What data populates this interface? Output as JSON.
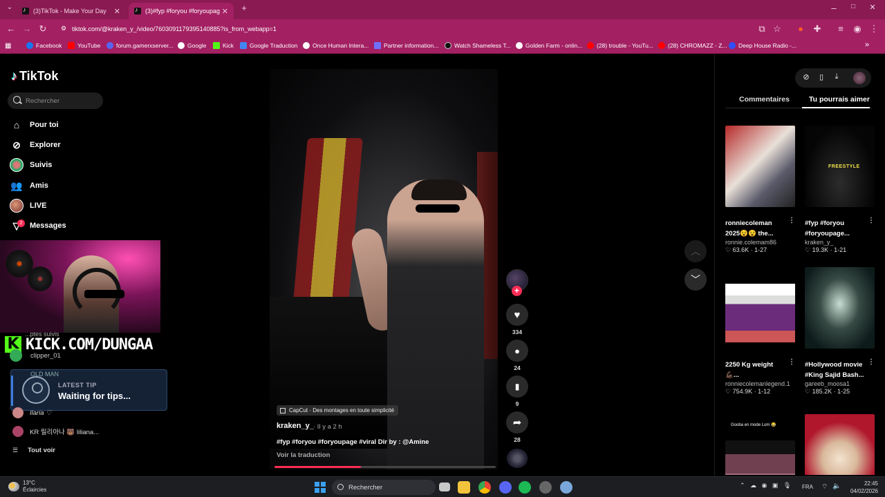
{
  "browser": {
    "tabs": [
      {
        "title": "(3)TikTok - Make Your Day",
        "active": false
      },
      {
        "title": "(3)#fyp #foryou #foryoupage #",
        "active": true
      }
    ],
    "new_tab": "+",
    "url": "tiktok.com/@kraken_y_/video/7603091179395140885?is_from_webapp=1",
    "bookmarks": [
      {
        "label": "Facebook",
        "color": "#1877f2"
      },
      {
        "label": "YouTube",
        "color": "#ff0000"
      },
      {
        "label": "forum.gamerxserver...",
        "color": "#5865f2"
      },
      {
        "label": "Google",
        "color": "#ffffff"
      },
      {
        "label": "Kick",
        "color": "#53fc18"
      },
      {
        "label": "Google Traduction",
        "color": "#4285f4"
      },
      {
        "label": "Once Human Intera...",
        "color": "#ffffff"
      },
      {
        "label": "Partner information...",
        "color": "#7070ff"
      },
      {
        "label": "Watch Shameless T...",
        "color": "#111111"
      },
      {
        "label": "Golden Farm - onlin...",
        "color": "#ffffff"
      },
      {
        "label": "(28) trouble - YouTu...",
        "color": "#ff0000"
      },
      {
        "label": "(28) CHROMAZZ - Z...",
        "color": "#ff0000"
      },
      {
        "label": "Deep House Radio -...",
        "color": "#3050ff"
      }
    ],
    "more_bookmarks": "»"
  },
  "sidebar": {
    "logo": "TikTok",
    "search_placeholder": "Rechercher",
    "items": [
      {
        "label": "Pour toi",
        "icon": "home-icon"
      },
      {
        "label": "Explorer",
        "icon": "compass-icon"
      },
      {
        "label": "Suivis",
        "icon": "avatar-icon"
      },
      {
        "label": "Amis",
        "icon": "friends-icon"
      },
      {
        "label": "LIVE",
        "icon": "live-avatar-icon"
      },
      {
        "label": "Messages",
        "icon": "messages-icon"
      }
    ],
    "messages_badge": "2",
    "followed_header": "...ptes suivis",
    "followed": [
      {
        "name": "clipper_01"
      },
      {
        "name": "Ilaria ♡"
      },
      {
        "name": "KR 릴리아나 🐻 liliana..."
      }
    ],
    "see_all": "Tout voir"
  },
  "overlay": {
    "kick_logo": "K",
    "kick_text": "KICK.COM/DUNGAA",
    "tip_user": "OLD MAN",
    "tip_label": "LATEST TIP",
    "tip_message": "Waiting for tips..."
  },
  "video": {
    "capcut": "CapCut · Des montages en toute simplicité",
    "author": "kraken_y_",
    "time_ago": "· Il y a 2 h",
    "caption": "#fyp #foryou #foryoupage #viral Dir by : @Amine",
    "translate": "Voir la traduction",
    "progress": 0.39
  },
  "actions": {
    "likes": "334",
    "comments": "24",
    "saves": "9",
    "shares": "28"
  },
  "right_panel": {
    "tabs": [
      "Commentaires",
      "Tu pourrais aimer"
    ],
    "active_tab": "Tu pourrais aimer",
    "cards": [
      {
        "title": "ronniecoleman 2025😵😵 the...",
        "user": "ronnie.colemam86",
        "stats": "♡ 63.6K · 1-27"
      },
      {
        "title": "#fyp #foryou #foryoupage...",
        "user": "kraken_y_",
        "stats": "♡ 19.3K · 1-21",
        "thumb_text": "FREESTYLE"
      },
      {
        "title": "2250 Kg weight 💪🏿...",
        "user": "ronniecolemanlegend.1",
        "stats": "♡ 754.9K · 1-12"
      },
      {
        "title": "#Hollywood movie #King Sajid Bash...",
        "user": "gareeb_moosa1",
        "stats": "♡ 185.2K · 1-25"
      },
      {
        "title": "",
        "user": "",
        "stats": "",
        "thumb_text": "Gooba en mode Lom 😂"
      },
      {
        "title": "",
        "user": "",
        "stats": ""
      }
    ]
  },
  "taskbar": {
    "temp": "13°C",
    "weather": "Éclaircies",
    "search": "Rechercher",
    "lang": "FRA",
    "time": "22:45",
    "date": "04/02/2026"
  }
}
